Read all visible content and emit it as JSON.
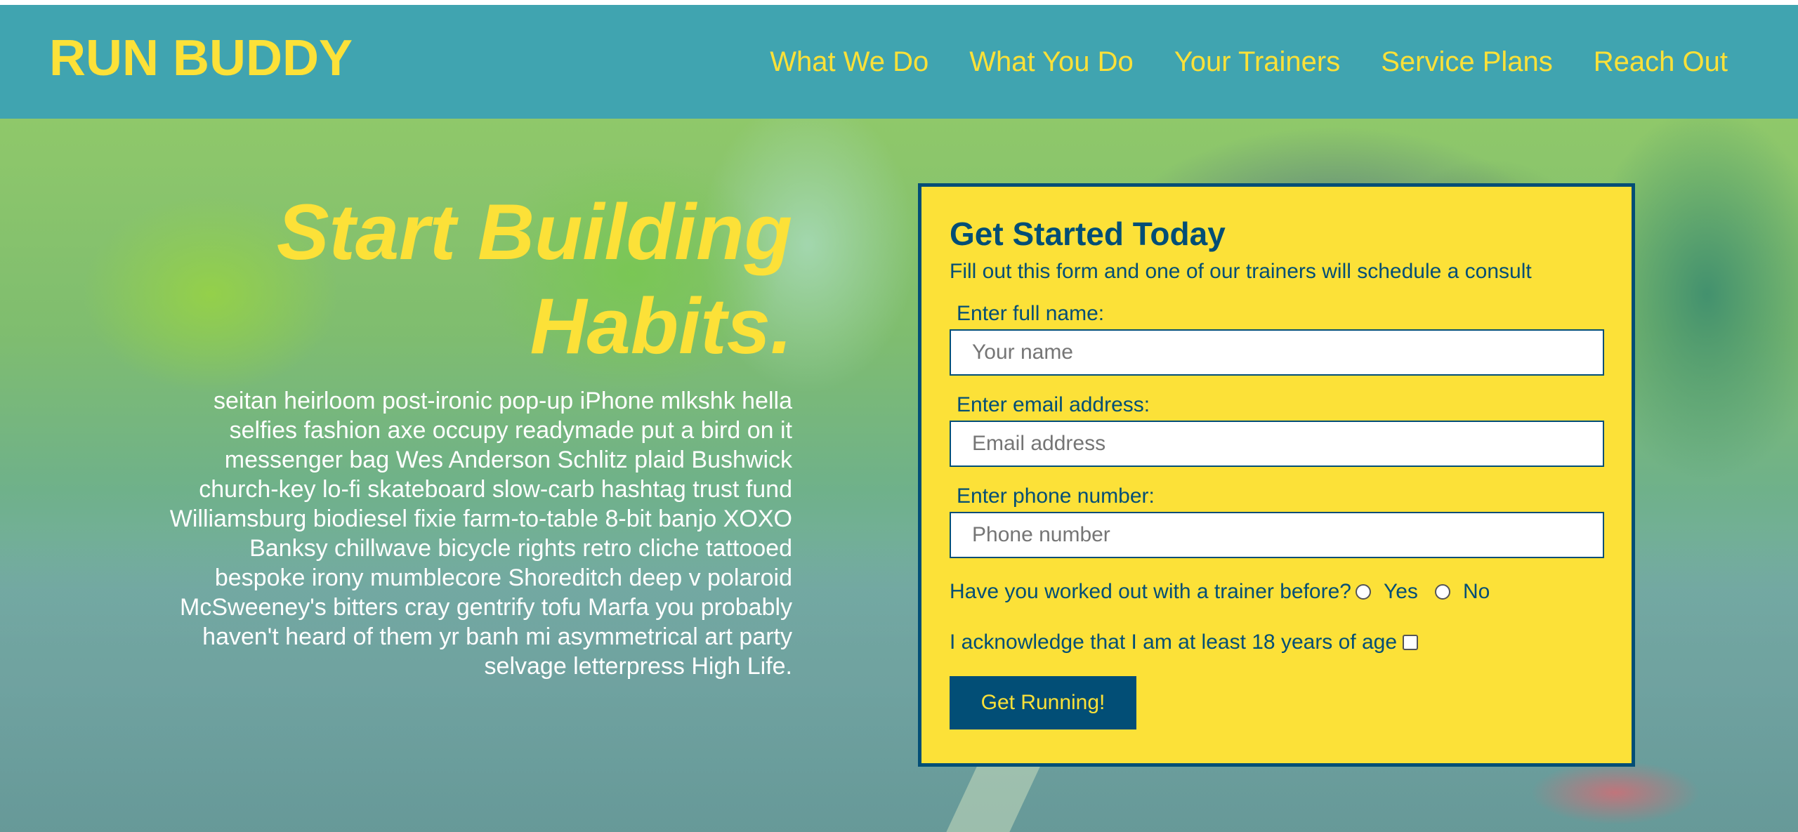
{
  "header": {
    "brand": "RUN BUDDY",
    "nav": [
      "What We Do",
      "What You Do",
      "Your Trainers",
      "Service Plans",
      "Reach Out"
    ]
  },
  "hero": {
    "title": "Start Building Habits.",
    "text": "seitan heirloom post-ironic pop-up iPhone mlkshk hella selfies fashion axe occupy readymade put a bird on it messenger bag Wes Anderson Schlitz plaid Bushwick church-key lo-fi skateboard slow-carb hashtag trust fund Williamsburg biodiesel fixie farm-to-table 8-bit banjo XOXO Banksy chillwave bicycle rights retro cliche tattooed bespoke irony mumblecore Shoreditch deep v polaroid McSweeney's bitters cray gentrify tofu Marfa you probably haven't heard of them yr banh mi asymmetrical art party selvage letterpress High Life."
  },
  "form": {
    "title": "Get Started Today",
    "subtitle": "Fill out this form and one of our trainers will schedule a consult",
    "fields": [
      {
        "label": "Enter full name:",
        "placeholder": "Your name"
      },
      {
        "label": "Enter email address:",
        "placeholder": "Email address"
      },
      {
        "label": "Enter phone number:",
        "placeholder": "Phone number"
      }
    ],
    "question": "Have you worked out with a trainer before?",
    "options": [
      "Yes",
      "No"
    ],
    "acknowledge": "I acknowledge that I am at least 18 years of age",
    "submit": "Get Running!"
  },
  "colors": {
    "header_bg": "#40a4b0",
    "accent_yellow": "#fce138",
    "dark_blue": "#024e76"
  }
}
